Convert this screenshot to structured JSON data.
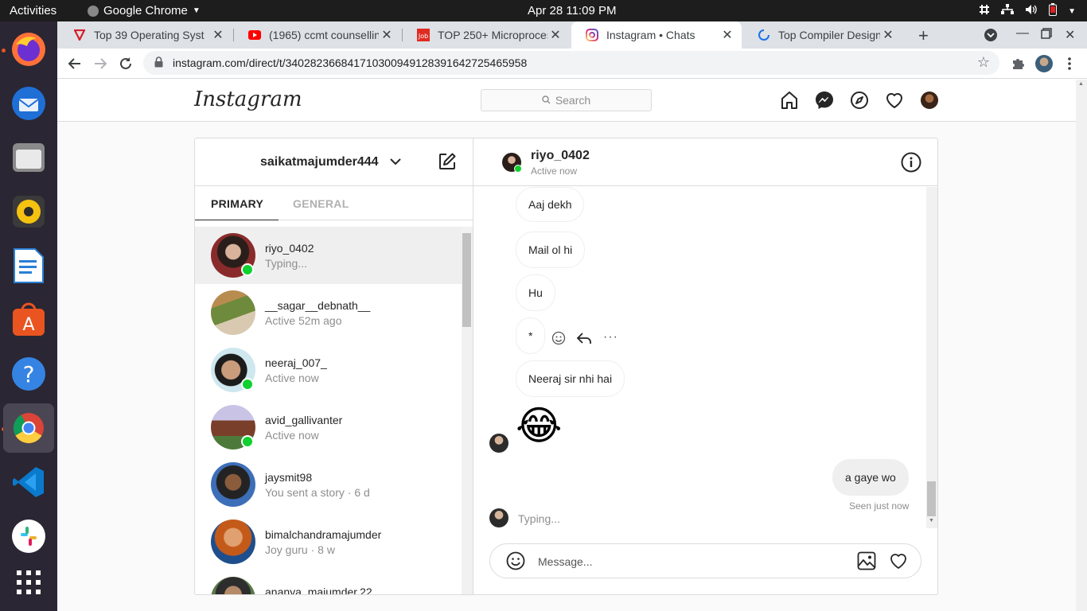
{
  "topbar": {
    "activities": "Activities",
    "app_name": "Google Chrome",
    "clock": "Apr 28  11:09 PM"
  },
  "browser": {
    "tabs": [
      {
        "title": "Top 39 Operating Syst",
        "icon": "tab-favicon-red-v"
      },
      {
        "title": "(1965) ccmt counsellin",
        "icon": "tab-favicon-youtube"
      },
      {
        "title": "TOP 250+ Microproces",
        "icon": "tab-favicon-job"
      },
      {
        "title": "Instagram • Chats",
        "icon": "tab-favicon-instagram"
      },
      {
        "title": "Top Compiler Design",
        "icon": "tab-favicon-loading"
      }
    ],
    "url": "instagram.com/direct/t/340282366841710300949128391642725465958"
  },
  "instagram": {
    "logo": "Instagram",
    "search_placeholder": "Search",
    "username": "saikatmajumder444",
    "tabs": {
      "primary": "PRIMARY",
      "general": "GENERAL"
    },
    "threads": [
      {
        "name": "riyo_0402",
        "sub": "Typing...",
        "online": true,
        "selected": true
      },
      {
        "name": "__sagar__debnath__",
        "sub": "Active 52m ago",
        "online": false
      },
      {
        "name": "neeraj_007_",
        "sub": "Active now",
        "online": true
      },
      {
        "name": "avid_gallivanter",
        "sub": "Active now",
        "online": true
      },
      {
        "name": "jaysmit98",
        "sub": "You sent a story · 6 d",
        "online": false
      },
      {
        "name": "bimalchandramajumder",
        "sub": "Joy guru · 8 w",
        "online": false
      },
      {
        "name": "ananya_majumder.22",
        "sub": "",
        "online": false
      }
    ],
    "chat": {
      "name": "riyo_0402",
      "status": "Active now",
      "messages": [
        {
          "text": "Aaj dekh"
        },
        {
          "text": "Mail ol hi"
        },
        {
          "text": "Hu"
        },
        {
          "text": "*"
        },
        {
          "text": "Neeraj sir nhi hai"
        },
        {
          "text": "😂"
        },
        {
          "text": "a gaye wo"
        }
      ],
      "seen": "Seen just now",
      "typing": "Typing...",
      "composer_placeholder": "Message..."
    }
  }
}
